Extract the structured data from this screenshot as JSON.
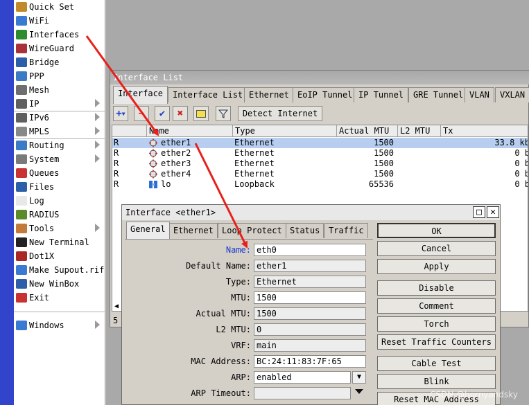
{
  "menu": [
    {
      "label": "Quick Set",
      "icon": "wand-icon",
      "color": "#c08a2a",
      "arrow": false
    },
    {
      "label": "WiFi",
      "icon": "wifi-icon",
      "color": "#3a7ad0",
      "arrow": false
    },
    {
      "label": "Interfaces",
      "icon": "ports-icon",
      "color": "#2e8b2e",
      "arrow": false
    },
    {
      "label": "WireGuard",
      "icon": "dragon-icon",
      "color": "#a8323a",
      "arrow": false
    },
    {
      "label": "Bridge",
      "icon": "bridge-icon",
      "color": "#2d5fa8",
      "arrow": false
    },
    {
      "label": "PPP",
      "icon": "ppp-icon",
      "color": "#3b7ac5",
      "arrow": false
    },
    {
      "label": "Mesh",
      "icon": "mesh-icon",
      "color": "#6e6e6e",
      "arrow": false
    },
    {
      "label": "IP",
      "icon": "ip-icon",
      "color": "#606060",
      "arrow": true
    },
    {
      "label": "IPv6",
      "icon": "ipv6-icon",
      "color": "#606060",
      "arrow": true
    },
    {
      "label": "MPLS",
      "icon": "mpls-icon",
      "color": "#888888",
      "arrow": true
    },
    {
      "label": "Routing",
      "icon": "routing-icon",
      "color": "#3b7ac5",
      "arrow": true
    },
    {
      "label": "System",
      "icon": "gear-icon",
      "color": "#7a7a7a",
      "arrow": true
    },
    {
      "label": "Queues",
      "icon": "queue-icon",
      "color": "#c83232",
      "arrow": false
    },
    {
      "label": "Files",
      "icon": "folder-icon",
      "color": "#2d5fa8",
      "arrow": false
    },
    {
      "label": "Log",
      "icon": "log-icon",
      "color": "#e8e8e8",
      "arrow": false
    },
    {
      "label": "RADIUS",
      "icon": "radius-icon",
      "color": "#5a8a2a",
      "arrow": false
    },
    {
      "label": "Tools",
      "icon": "tools-icon",
      "color": "#c07a3a",
      "arrow": true
    },
    {
      "label": "New Terminal",
      "icon": "terminal-icon",
      "color": "#222222",
      "arrow": false
    },
    {
      "label": "Dot1X",
      "icon": "dot1x-icon",
      "color": "#a82828",
      "arrow": false
    },
    {
      "label": "Make Supout.rif",
      "icon": "supout-icon",
      "color": "#3a7ad0",
      "arrow": false
    },
    {
      "label": "New WinBox",
      "icon": "winbox-icon",
      "color": "#2d5fa8",
      "arrow": false
    },
    {
      "label": "Exit",
      "icon": "exit-icon",
      "color": "#c83232",
      "arrow": false
    },
    {
      "label": "Windows",
      "icon": "windows-icon",
      "color": "#3a7ad0",
      "arrow": true
    }
  ],
  "iflist": {
    "title": "Interface List",
    "tabs": [
      "Interface",
      "Interface List",
      "Ethernet",
      "EoIP Tunnel",
      "IP Tunnel",
      "GRE Tunnel",
      "VLAN",
      "VXLAN"
    ],
    "detect_label": "Detect Internet",
    "columns": [
      "",
      "Name",
      "Type",
      "Actual MTU",
      "L2 MTU",
      "Tx"
    ],
    "rows": [
      {
        "flag": "R",
        "name": "ether1",
        "type": "Ethernet",
        "mtu": "1500",
        "l2mtu": "",
        "tx": "33.8 kb",
        "selected": true
      },
      {
        "flag": "R",
        "name": "ether2",
        "type": "Ethernet",
        "mtu": "1500",
        "l2mtu": "",
        "tx": "0 b",
        "selected": false
      },
      {
        "flag": "R",
        "name": "ether3",
        "type": "Ethernet",
        "mtu": "1500",
        "l2mtu": "",
        "tx": "0 b",
        "selected": false
      },
      {
        "flag": "R",
        "name": "ether4",
        "type": "Ethernet",
        "mtu": "1500",
        "l2mtu": "",
        "tx": "0 b",
        "selected": false
      },
      {
        "flag": "R",
        "name": "lo",
        "type": "Loopback",
        "mtu": "65536",
        "l2mtu": "",
        "tx": "0 b",
        "selected": false
      }
    ],
    "count": "5"
  },
  "dialog": {
    "title": "Interface <ether1>",
    "tabs": [
      "General",
      "Ethernet",
      "Loop Protect",
      "Status",
      "Traffic"
    ],
    "fields": [
      {
        "label": "Name:",
        "value": "eth0",
        "kind": "edit"
      },
      {
        "label": "Default Name:",
        "value": "ether1",
        "kind": "ro"
      },
      {
        "label": "Type:",
        "value": "Ethernet",
        "kind": "ro"
      },
      {
        "label": "MTU:",
        "value": "1500",
        "kind": "edit"
      },
      {
        "label": "Actual MTU:",
        "value": "1500",
        "kind": "ro"
      },
      {
        "label": "L2 MTU:",
        "value": "0",
        "kind": "ro"
      },
      {
        "label": "VRF:",
        "value": "main",
        "kind": "ro"
      },
      {
        "label": "MAC Address:",
        "value": "BC:24:11:83:7F:65",
        "kind": "edit"
      },
      {
        "label": "ARP:",
        "value": "enabled",
        "kind": "edit"
      },
      {
        "label": "ARP Timeout:",
        "value": "",
        "kind": "ro"
      }
    ],
    "buttons": [
      "OK",
      "Cancel",
      "Apply",
      "Disable",
      "Comment",
      "Torch",
      "Reset Traffic Counters",
      "Cable Test",
      "Blink",
      "Reset MAC Address"
    ]
  },
  "watermark": "CSDN @hornyandsky",
  "colors": {
    "accent_strip": "#3344cc",
    "selection": "#b8cef0",
    "arrow": "#e8201c",
    "label_highlight": "#1a3cc8"
  }
}
